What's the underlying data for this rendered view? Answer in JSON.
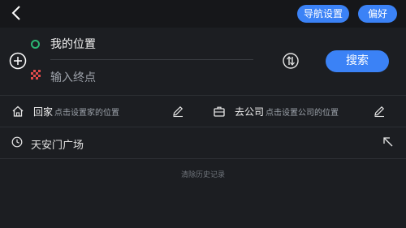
{
  "header": {
    "back_icon": "chevron-left-icon",
    "nav_settings_label": "导航设置",
    "preferences_label": "偏好"
  },
  "route": {
    "add_stop_icon": "plus-circle-icon",
    "start_value": "我的位置",
    "start_color": "#2bb673",
    "end_placeholder": "输入终点",
    "end_flag_icon": "checkered-flag-icon",
    "swap_icon": "swap-icon",
    "search_label": "搜索"
  },
  "shortcuts": {
    "home": {
      "icon": "home-icon",
      "title": "回家",
      "hint": "点击设置家的位置",
      "edit_icon": "pencil-icon"
    },
    "work": {
      "icon": "briefcase-icon",
      "title": "去公司",
      "hint": "点击设置公司的位置",
      "edit_icon": "pencil-icon"
    }
  },
  "history": {
    "items": [
      {
        "icon": "clock-icon",
        "text": "天安门广场",
        "action_icon": "arrow-up-left-icon"
      }
    ],
    "clear_label": "清除历史记录"
  },
  "colors": {
    "accent": "#3b82f6",
    "background": "#1c1e22",
    "topbar": "#16171a"
  }
}
